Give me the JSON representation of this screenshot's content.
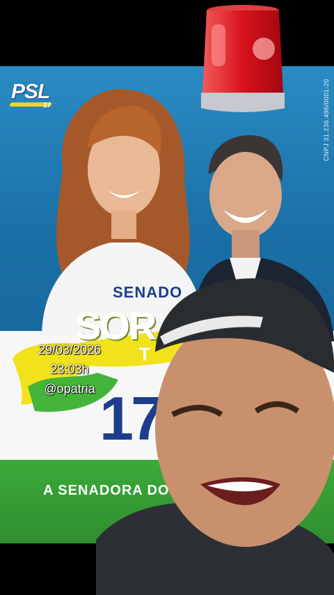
{
  "poster": {
    "party_logo": "PSL",
    "party_number": "17",
    "cnpj": "CNPJ 31.236.496/0001-20",
    "senador_label": "SENADO",
    "name_fragment": "SOR",
    "name_small": "T",
    "number": "17",
    "slogan": "A SENADORA DO"
  },
  "stamp": {
    "date": "29/03/2026",
    "time": "23:03h",
    "handle": "@opatria"
  },
  "icons": {
    "siren": "red-siren-icon"
  },
  "colors": {
    "poster_blue": "#1a6fa6",
    "poster_green": "#2e8f2e",
    "brand_navy": "#1d3d8c",
    "brazil_yellow": "#f2e21c",
    "siren_red": "#d8121c"
  }
}
